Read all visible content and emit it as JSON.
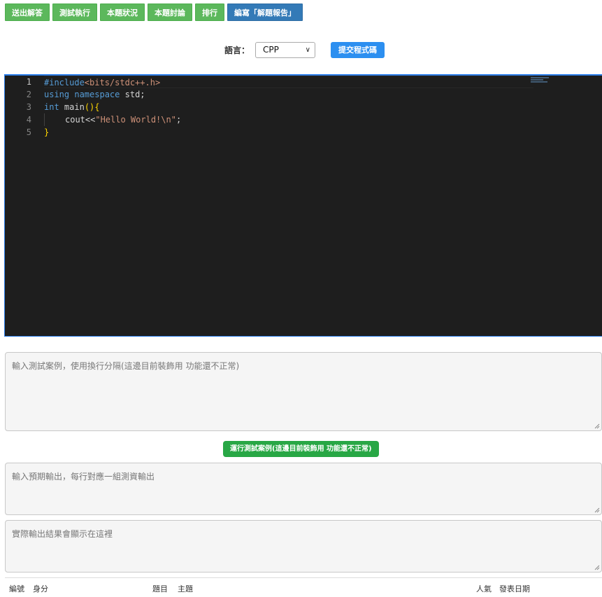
{
  "tabs": [
    {
      "label": "送出解答"
    },
    {
      "label": "測試執行"
    },
    {
      "label": "本題狀況"
    },
    {
      "label": "本題討論"
    },
    {
      "label": "排行"
    },
    {
      "label": "編寫「解題報告」"
    }
  ],
  "language": {
    "label": "語言：",
    "selected": "CPP",
    "submit_label": "提交程式碼"
  },
  "editor": {
    "line_numbers": [
      "1",
      "2",
      "3",
      "4",
      "5"
    ],
    "lines": [
      "#include<bits/stdc++.h>",
      "using namespace std;",
      "int main(){",
      "    cout<<\"Hello World!\\n\";",
      "}"
    ]
  },
  "test_input": {
    "placeholder": "輸入測試案例，使用換行分隔(這邊目前裝飾用 功能還不正常)"
  },
  "run_button": {
    "label": "運行測試案例(這邊目前裝飾用 功能還不正常)"
  },
  "expected_output": {
    "placeholder": "輸入預期輸出，每行對應一組測資輸出"
  },
  "actual_output": {
    "placeholder": "實際輸出結果會顯示在這裡"
  },
  "table_header": {
    "columns": [
      "編號",
      "身分",
      "題目",
      "主題",
      "人氣",
      "發表日期"
    ]
  },
  "colors": {
    "tab_green": "#5cb85c",
    "tab_blue": "#337ab7",
    "submit_blue": "#2c8ff0",
    "run_green": "#28a745",
    "editor_bg": "#1e1e1e"
  }
}
